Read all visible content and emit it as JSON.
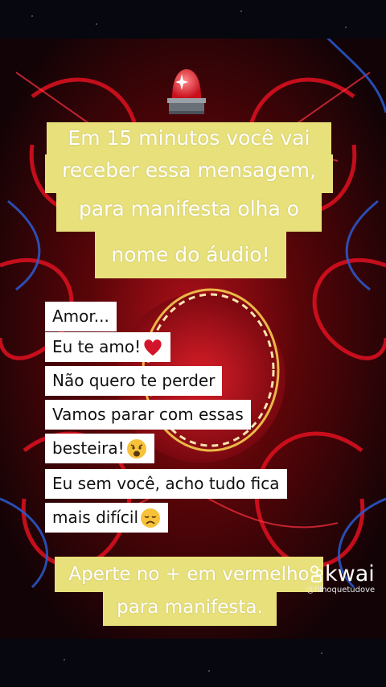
{
  "header_caption": {
    "lines": [
      "Em 15 minutos você vai",
      "receber essa mensagem,",
      "para manifesta olha o",
      "nome do áudio!"
    ]
  },
  "message_lines": [
    {
      "text": "Amor...",
      "emoji": ""
    },
    {
      "text": "Eu te amo!",
      "emoji": "heart-icon"
    },
    {
      "text": "Não quero te perder",
      "emoji": ""
    },
    {
      "text": "Vamos parar com essas",
      "emoji": ""
    },
    {
      "text": "besteira!",
      "emoji": "anguished-face-icon"
    },
    {
      "text": "Eu sem você, acho tudo fica",
      "emoji": ""
    },
    {
      "text": "mais difícil",
      "emoji": "disappointed-face-icon"
    }
  ],
  "footer_caption": {
    "lines": [
      "Aperte no + em vermelho",
      "para manifesta."
    ]
  },
  "watermark": {
    "brand": "kwai",
    "handle": "@filhoquetudove"
  },
  "colors": {
    "caption_bg": "#e8e07a",
    "caption_text": "#ffffff",
    "background_red": "#c8101e",
    "background_blue": "#2a5bd0"
  }
}
